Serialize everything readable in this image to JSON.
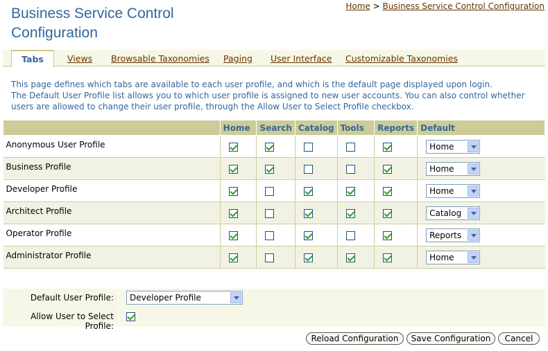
{
  "page": {
    "title": "Business Service Control Configuration"
  },
  "breadcrumb": {
    "home": "Home",
    "separator": ">",
    "current": "Business Service Control Configuration"
  },
  "tabs": [
    {
      "label": "Tabs",
      "active": true
    },
    {
      "label": "Views",
      "active": false
    },
    {
      "label": "Browsable Taxonomies",
      "active": false
    },
    {
      "label": "Paging",
      "active": false
    },
    {
      "label": "User Interface",
      "active": false
    },
    {
      "label": "Customizable Taxonomies",
      "active": false
    }
  ],
  "description": {
    "line1": "This page defines which tabs are available to each user profile, and which is the default page displayed upon login.",
    "line2": "The Default User Profile list allows you to which user profile is assigned to new user accounts. You can also control whether users are allowed to change their user profile, through the Allow User to Select Profile checkbox."
  },
  "table": {
    "headers": {
      "profile": "",
      "home": "Home",
      "search": "Search",
      "catalog": "Catalog",
      "tools": "Tools",
      "reports": "Reports",
      "default": "Default"
    },
    "rows": [
      {
        "name": "Anonymous User Profile",
        "home": true,
        "search": true,
        "catalog": false,
        "tools": false,
        "reports": true,
        "default": "Home"
      },
      {
        "name": "Business Profile",
        "home": true,
        "search": true,
        "catalog": false,
        "tools": false,
        "reports": true,
        "default": "Home"
      },
      {
        "name": "Developer Profile",
        "home": true,
        "search": false,
        "catalog": true,
        "tools": true,
        "reports": true,
        "default": "Home"
      },
      {
        "name": "Architect Profile",
        "home": true,
        "search": false,
        "catalog": true,
        "tools": true,
        "reports": true,
        "default": "Catalog"
      },
      {
        "name": "Operator Profile",
        "home": true,
        "search": false,
        "catalog": true,
        "tools": false,
        "reports": true,
        "default": "Reports"
      },
      {
        "name": "Administrator Profile",
        "home": true,
        "search": false,
        "catalog": true,
        "tools": true,
        "reports": true,
        "default": "Home"
      }
    ]
  },
  "form": {
    "default_profile_label": "Default User Profile:",
    "default_profile_value": "Developer Profile",
    "allow_select_label": "Allow User to Select Profile:",
    "allow_select_checked": true
  },
  "buttons": {
    "reload": "Reload Configuration",
    "save": "Save Configuration",
    "cancel": "Cancel"
  },
  "colors": {
    "title": "#336699",
    "link": "#663300",
    "header_bg": "#cccc99",
    "band": "#f2f2e4",
    "check": "#21a121"
  }
}
